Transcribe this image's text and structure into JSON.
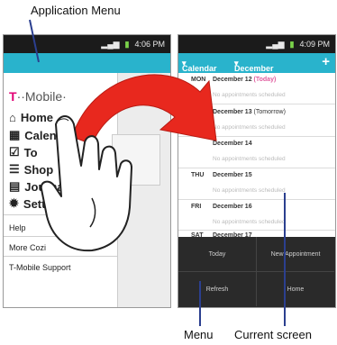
{
  "callouts": {
    "application_menu": "Application Menu",
    "menu": "Menu",
    "current_screen": "Current screen"
  },
  "left_phone": {
    "time": "4:06 PM",
    "logo_t": "T",
    "logo_rest": "··Mobile·",
    "menu_items": [
      {
        "label": "Home",
        "icon": "home-icon"
      },
      {
        "label": "Calendar",
        "icon": "calendar-icon"
      },
      {
        "label": "To Do",
        "icon": "todo-icon"
      },
      {
        "label": "Shopping",
        "icon": "shopping-icon"
      },
      {
        "label": "Journal",
        "icon": "journal-icon"
      },
      {
        "label": "Settings",
        "icon": "gear-icon"
      }
    ],
    "visible_labels": [
      "Home",
      "Calendar",
      "To",
      "Shop",
      "Journa",
      "Settings"
    ],
    "secondary_items": [
      "Help",
      "More Cozi",
      "T-Mobile Support"
    ]
  },
  "right_phone": {
    "time": "4:09 PM",
    "calendar_tab": "Calendar",
    "month_tab": "December",
    "plus_label": "+",
    "days": [
      {
        "dow": "MON",
        "date": "December 12",
        "tag": "(Today)",
        "note": "No appointments scheduled"
      },
      {
        "dow": "",
        "date": "December 13",
        "tag": "(Tomorrow)",
        "note": "No appointments scheduled"
      },
      {
        "dow": "",
        "date": "December 14",
        "tag": "",
        "note": "No appointments scheduled"
      },
      {
        "dow": "THU",
        "date": "December 15",
        "tag": "",
        "note": "No appointments scheduled"
      },
      {
        "dow": "FRI",
        "date": "December 16",
        "tag": "",
        "note": "No appointments scheduled"
      },
      {
        "dow": "SAT",
        "date": "December 17",
        "tag": "",
        "note": ""
      }
    ],
    "bottom_menu": [
      "Today",
      "New Appointment",
      "Refresh",
      "Home"
    ]
  },
  "colors": {
    "accent_teal": "#29b3cc",
    "arrow_red": "#e8281e",
    "callout_line": "#2b3f8f",
    "today_pink": "#e05a9e"
  }
}
